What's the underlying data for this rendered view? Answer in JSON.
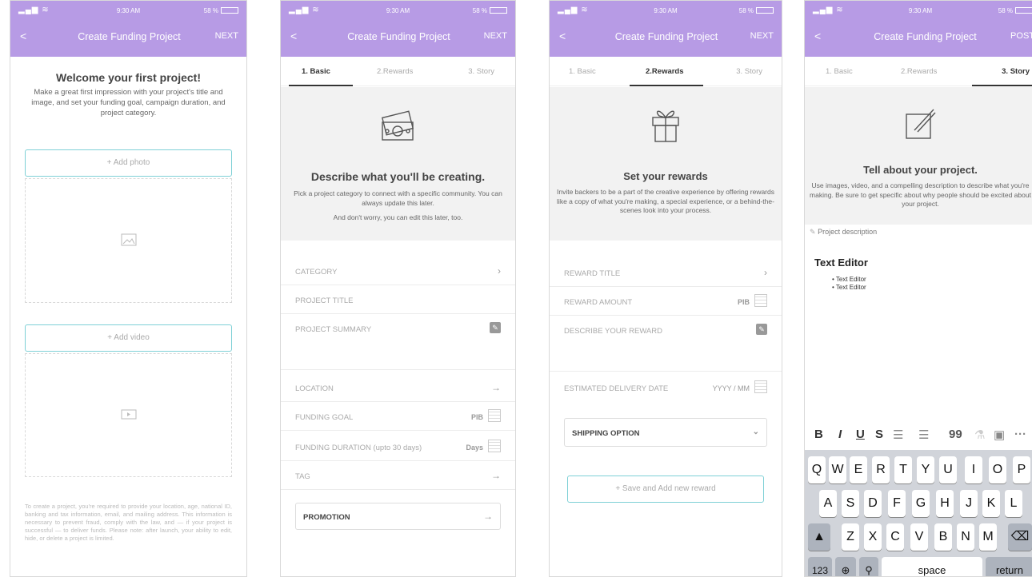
{
  "status": {
    "time": "9:30 AM",
    "battery": "58 %"
  },
  "nav": {
    "title": "Create Funding Project",
    "next": "NEXT",
    "post": "POST",
    "back": "<"
  },
  "tabs": {
    "basic": "1. Basic",
    "rewards": "2.Rewards",
    "story": "3. Story"
  },
  "screen1": {
    "heading": "Welcome your first project!",
    "intro": "Make a great first impression with your project's title and image, and set your funding goal, campaign duration, and project category.",
    "add_photo": "+ Add photo",
    "add_video": "+ Add video",
    "fineprint": "To create a project, you're required to provide your location, age, national ID, banking and tax information, email, and mailing address. This information is necessary to prevent fraud, comply with the law, and — if your project is successful — to deliver funds. Please note: after launch, your ability to edit, hide, or delete a project is limited."
  },
  "screen2": {
    "heading": "Describe what you'll be creating.",
    "intro": "Pick a project category to connect with a specific community. You can always update this later.",
    "intro2": "And don't worry, you can edit this later, too.",
    "fields": {
      "category": "CATEGORY",
      "title": "PROJECT TITLE",
      "summary": "PROJECT SUMMARY",
      "location": "LOCATION",
      "goal": "FUNDING GOAL",
      "goal_unit": "PIB",
      "duration": "FUNDING DURATION (upto 30 days)",
      "duration_unit": "Days",
      "tag": "TAG",
      "promotion": "PROMOTION"
    }
  },
  "screen3": {
    "heading": "Set your rewards",
    "intro": "Invite backers to be a part of the creative experience by offering rewards like a copy of what you're making, a special experience, or a behind-the-scenes look into your process.",
    "fields": {
      "reward_title": "REWARD TITLE",
      "reward_amount": "REWARD AMOUNT",
      "amount_unit": "PIB",
      "describe": "DESCRIBE YOUR REWARD",
      "delivery": "ESTIMATED DELIVERY DATE",
      "date_format": "YYYY / MM",
      "shipping": "SHIPPING OPTION"
    },
    "save_add": "+ Save and Add new reward"
  },
  "screen4": {
    "heading": "Tell about your project.",
    "intro": "Use images, video, and a compelling description to describe what you're making. Be sure to get specific about why people should be excited about your project.",
    "desc_label": "Project description",
    "editor_title": "Text Editor",
    "editor_items": [
      "Text Editor",
      "Text Editor"
    ],
    "toolbar": [
      "B",
      "I",
      "U",
      "S",
      "☰",
      "☰",
      "99",
      "⚗",
      "▣",
      "···"
    ],
    "keyboard": {
      "row1": [
        "Q",
        "W",
        "E",
        "R",
        "T",
        "Y",
        "U",
        "I",
        "O",
        "P"
      ],
      "row2": [
        "A",
        "S",
        "D",
        "F",
        "G",
        "H",
        "J",
        "K",
        "L"
      ],
      "row3": [
        "Z",
        "X",
        "C",
        "V",
        "B",
        "N",
        "M"
      ],
      "num": "123",
      "space": "space",
      "return": "return"
    }
  }
}
